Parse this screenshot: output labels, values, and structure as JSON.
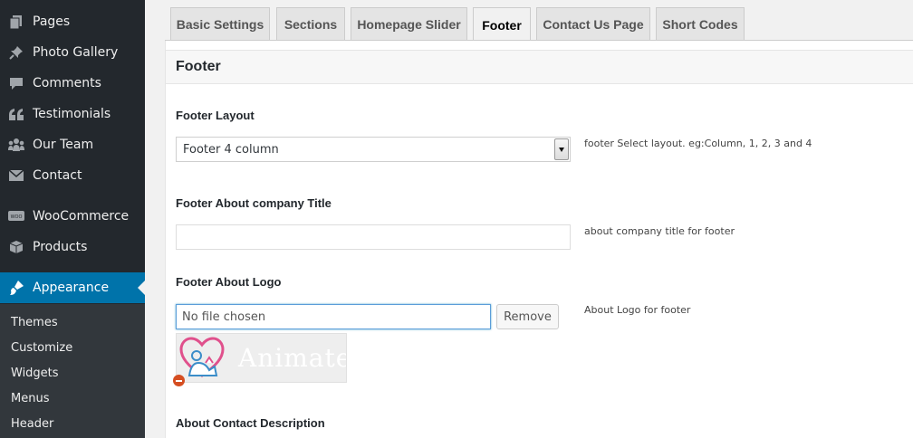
{
  "sidebar": {
    "items": [
      {
        "label": "Pages",
        "icon": "pages-icon"
      },
      {
        "label": "Photo Gallery",
        "icon": "pin-icon"
      },
      {
        "label": "Comments",
        "icon": "comment-icon"
      },
      {
        "label": "Testimonials",
        "icon": "quote-icon"
      },
      {
        "label": "Our Team",
        "icon": "groups-icon"
      },
      {
        "label": "Contact",
        "icon": "email-icon"
      },
      {
        "label": "WooCommerce",
        "icon": "woo-icon"
      },
      {
        "label": "Products",
        "icon": "cube-icon"
      },
      {
        "label": "Appearance",
        "icon": "brush-icon",
        "active": true
      }
    ],
    "submenu": [
      {
        "label": "Themes"
      },
      {
        "label": "Customize"
      },
      {
        "label": "Widgets"
      },
      {
        "label": "Menus"
      },
      {
        "label": "Header"
      }
    ],
    "active_color": "#0073aa"
  },
  "tabs": [
    {
      "label": "Basic Settings"
    },
    {
      "label": "Sections"
    },
    {
      "label": "Homepage Slider"
    },
    {
      "label": "Footer",
      "active": true
    },
    {
      "label": "Contact Us Page"
    },
    {
      "label": "Short Codes"
    }
  ],
  "panel": {
    "title": "Footer",
    "fields": {
      "layout": {
        "label": "Footer Layout",
        "value": "Footer 4 column",
        "help": "footer Select layout. eg:Column, 1, 2, 3 and 4"
      },
      "about_title": {
        "label": "Footer About company Title",
        "value": "",
        "help": "about company title for footer"
      },
      "about_logo": {
        "label": "Footer About Logo",
        "file_value": "No file chosen",
        "remove_label": "Remove",
        "help": "About Logo for footer",
        "preview_text": "Animate"
      },
      "contact_description": {
        "label": "About Contact Description"
      }
    }
  }
}
